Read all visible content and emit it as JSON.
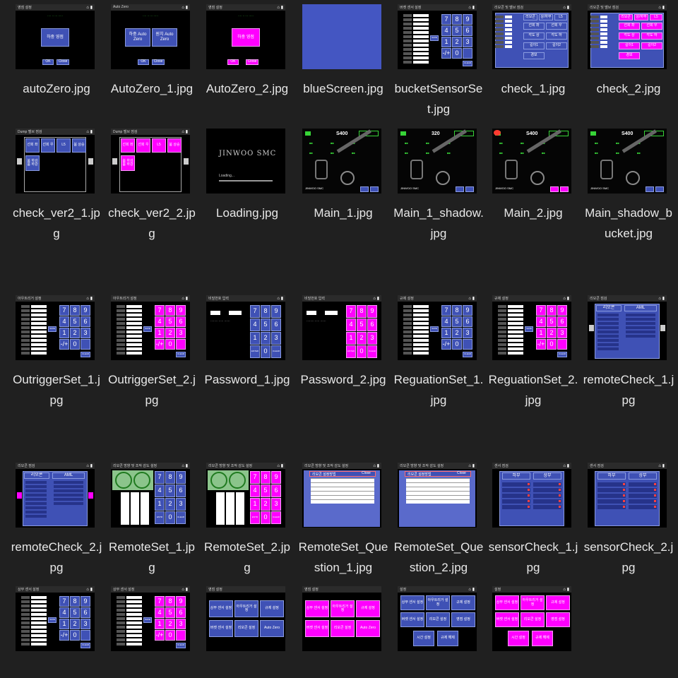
{
  "files": [
    {
      "name": "autoZero.jpg",
      "kind": "az0",
      "title": "영점 설정"
    },
    {
      "name": "AutoZero_1.jpg",
      "kind": "az1",
      "title": "Auto Zero"
    },
    {
      "name": "AutoZero_2.jpg",
      "kind": "az2",
      "title": "영점 설정"
    },
    {
      "name": "blueScreen.jpg",
      "kind": "blue",
      "title": ""
    },
    {
      "name": "bucketSensorSet.jpg",
      "kind": "keypad",
      "title": "버켓 센서 설정"
    },
    {
      "name": "check_1.jpg",
      "kind": "check1",
      "title": "리모콘 및 밸브 점검"
    },
    {
      "name": "check_2.jpg",
      "kind": "check2",
      "title": "리모콘 및 밸브 점검"
    },
    {
      "name": "check_ver2_1.jpg",
      "kind": "cv1",
      "title": "Dump 밸브 점검"
    },
    {
      "name": "check_ver2_2.jpg",
      "kind": "cv2",
      "title": "Dump 밸브 점검"
    },
    {
      "name": "Loading.jpg",
      "kind": "loading",
      "title": ""
    },
    {
      "name": "Main_1.jpg",
      "kind": "main",
      "title": "S400"
    },
    {
      "name": "Main_1_shadow.jpg",
      "kind": "main",
      "title": "320"
    },
    {
      "name": "Main_2.jpg",
      "kind": "main2",
      "title": "S400"
    },
    {
      "name": "Main_shadow_bucket.jpg",
      "kind": "main",
      "title": "S400"
    },
    {
      "name": "OutriggerSet_1.jpg",
      "kind": "keypad",
      "title": "아우트리거 설정"
    },
    {
      "name": "OutriggerSet_2.jpg",
      "kind": "keypadm",
      "title": "아우트리거 설정"
    },
    {
      "name": "Password_1.jpg",
      "kind": "pw1",
      "title": "비밀번호 입력"
    },
    {
      "name": "Password_2.jpg",
      "kind": "pw2",
      "title": "비밀번호 입력"
    },
    {
      "name": "ReguationSet_1.jpg",
      "kind": "keypad",
      "title": "규제 설정"
    },
    {
      "name": "ReguationSet_2.jpg",
      "kind": "keypadm",
      "title": "규제 설정"
    },
    {
      "name": "remoteCheck_1.jpg",
      "kind": "rc1",
      "title": "리모콘 점검"
    },
    {
      "name": "remoteCheck_2.jpg",
      "kind": "rc2",
      "title": "리모콘 점검"
    },
    {
      "name": "RemoteSet_1.jpg",
      "kind": "rs1",
      "title": "리모콘 방향 및 조작 감도 설정"
    },
    {
      "name": "RemoteSet_2.jpg",
      "kind": "rs2",
      "title": "리모콘 방향 및 조작 감도 설정"
    },
    {
      "name": "RemoteSet_Question_1.jpg",
      "kind": "rq",
      "title": "리모콘 방향 및 조작 감도 설정"
    },
    {
      "name": "RemoteSet_Question_2.jpg",
      "kind": "rq",
      "title": "리모콘 방향 및 조작 감도 설정"
    },
    {
      "name": "sensorCheck_1.jpg",
      "kind": "sc",
      "title": "센서 점검"
    },
    {
      "name": "sensorCheck_2.jpg",
      "kind": "sc",
      "title": "센서 점검"
    },
    {
      "name": "",
      "kind": "keypad",
      "title": "상부 센서 설정"
    },
    {
      "name": "",
      "kind": "keypadm",
      "title": "상부 센서 설정"
    },
    {
      "name": "",
      "kind": "menu1",
      "title": ""
    },
    {
      "name": "",
      "kind": "menu2",
      "title": ""
    },
    {
      "name": "",
      "kind": "menu3",
      "title": "설정"
    },
    {
      "name": "",
      "kind": "menu4",
      "title": "설정"
    }
  ],
  "ui": {
    "keys": [
      "7",
      "8",
      "9",
      "4",
      "5",
      "6",
      "1",
      "2",
      "3",
      "-/+",
      "0",
      ""
    ],
    "az_text": [
      "하중 영점",
      "OK",
      "Close"
    ],
    "az1_text": [
      "하중",
      "Auto Zero",
      "원치",
      "Auto Zero",
      "OK",
      "Close"
    ],
    "check_text": [
      "리모콘",
      "상/하부",
      "L5",
      "선회 좌",
      "선회 우",
      "각도 상",
      "각도 하",
      "길이1",
      "길이2",
      "경보"
    ],
    "cv_text": [
      "선회 좌",
      "선회 우",
      "L5",
      "붐 상승",
      "붐 하강",
      "붐 하강"
    ],
    "loading_text": [
      "JINWOO SMC",
      "Loading..."
    ],
    "pw_text": "비밀번호 입력",
    "rc_text": [
      "리모콘",
      "AML"
    ],
    "rq_text": [
      "리모콘 설정방법",
      "Close"
    ],
    "sc_text": [
      "하부",
      "상부"
    ],
    "menu_text": [
      "상부 센서 설정",
      "아우트리거 설정",
      "규제 설정",
      "버켓 센서 설정",
      "리모콘 설정",
      "Auto Zero",
      "시간 설정",
      "규제 해제",
      "영점 설정"
    ]
  }
}
